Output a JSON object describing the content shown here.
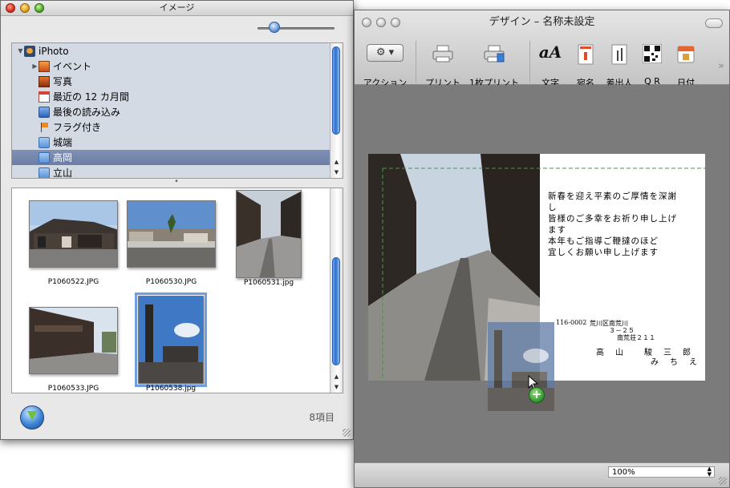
{
  "image_window": {
    "title": "イメージ",
    "sources": [
      {
        "label": "iPhoto",
        "icon": "iphoto-icon",
        "expanded": true
      },
      {
        "label": "イベント",
        "icon": "event-icon",
        "collapsed": true
      },
      {
        "label": "写真",
        "icon": "photo-icon"
      },
      {
        "label": "最近の 12 カ月間",
        "icon": "calendar-icon"
      },
      {
        "label": "最後の読み込み",
        "icon": "import-icon"
      },
      {
        "label": "フラグ付き",
        "icon": "flag-icon"
      },
      {
        "label": "城端",
        "icon": "album-icon"
      },
      {
        "label": "高岡",
        "icon": "album-icon",
        "selected": true
      },
      {
        "label": "立山",
        "icon": "album-icon"
      }
    ],
    "thumbnails": [
      {
        "filename": "P1060522.JPG"
      },
      {
        "filename": "P1060530.JPG"
      },
      {
        "filename": "P1060531.jpg"
      },
      {
        "filename": "P1060533.JPG"
      },
      {
        "filename": "P1060538.jpg",
        "selected": true
      }
    ],
    "item_count": "8項目"
  },
  "design_window": {
    "title": "デザイン – 名称未設定",
    "toolbar": {
      "action": "アクション",
      "print": "プリント",
      "print_one": "1枚プリント",
      "text": "文字",
      "addressee": "宛名",
      "sender": "差出人",
      "qr": "Q R",
      "date": "日付"
    },
    "text_icon_glyph": "aA",
    "card": {
      "message": [
        "新春を迎え平素のご厚情を深謝",
        "し",
        "皆様のご多幸をお祈り申し上げ",
        "ます",
        "本年もご指導ご鞭撻のほど",
        "宜しくお願い申し上げます"
      ],
      "postal": "116-0002",
      "address_1": "荒川区南荒川",
      "address_2": "３－２５",
      "address_3": "南荒荘２１１",
      "name_row_1": "高　山　　駿　三　郎",
      "name_row_2": "み　ち　え"
    },
    "zoom": "100%"
  },
  "colors": {
    "selection": "#6c7ea6",
    "scroll_thumb": "#2d6fd0",
    "guide": "#3aa13a",
    "add_badge": "#3aa13a"
  }
}
